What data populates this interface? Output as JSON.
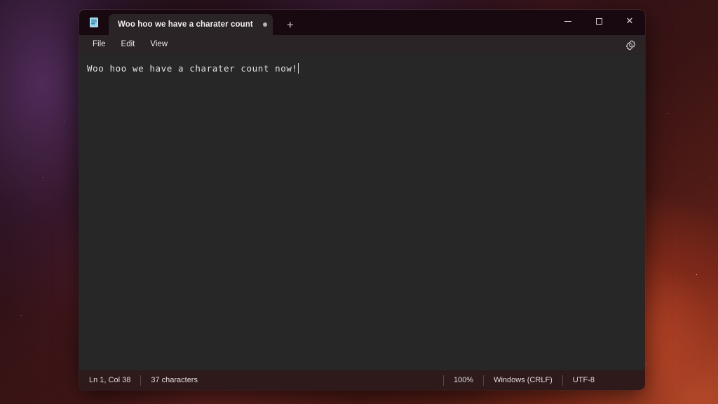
{
  "window": {
    "app_icon_name": "notepad-document-icon",
    "controls": {
      "minimize_label": "–",
      "maximize_label": "□",
      "close_label": "✕"
    }
  },
  "tabs": [
    {
      "title": "Woo hoo we have a charater count",
      "modified": true,
      "active": true
    }
  ],
  "tabstrip": {
    "new_tab_label": "+"
  },
  "menubar": {
    "items": [
      {
        "label": "File"
      },
      {
        "label": "Edit"
      },
      {
        "label": "View"
      }
    ],
    "settings_icon": "gear-icon"
  },
  "editor": {
    "content": "Woo hoo we have a charater count now!"
  },
  "statusbar": {
    "cursor_position": "Ln 1, Col 38",
    "character_count": "37 characters",
    "zoom_level": "100%",
    "line_ending": "Windows (CRLF)",
    "encoding": "UTF-8"
  },
  "colors": {
    "titlebar_bg": "#17090f",
    "tab_bg": "#2a2427",
    "menubar_bg": "#2a2427",
    "editor_bg": "#272727",
    "statusbar_bg": "#2e1a1b",
    "icon_accent": "#6fc3e8",
    "text_primary": "#f2eef0"
  }
}
